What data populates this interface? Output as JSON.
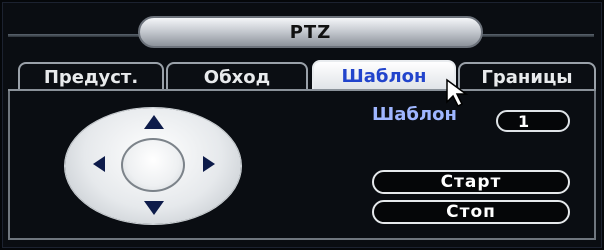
{
  "window": {
    "title": "PTZ"
  },
  "tabs": [
    {
      "label": "Предуст.",
      "active": false
    },
    {
      "label": "Обход",
      "active": false
    },
    {
      "label": "Шаблон",
      "active": true
    },
    {
      "label": "Границы",
      "active": false
    }
  ],
  "pattern": {
    "label": "Шаблон",
    "value": "1"
  },
  "buttons": {
    "start": "Старт",
    "stop": "Стоп"
  },
  "colors": {
    "label_blue": "#9fb6ff",
    "active_tab_text": "#2244cc",
    "arrow": "#0d1b4a"
  },
  "icons": {
    "up": "arrow-up-icon",
    "down": "arrow-down-icon",
    "left": "arrow-left-icon",
    "right": "arrow-right-icon",
    "cursor": "mouse-pointer-icon"
  }
}
